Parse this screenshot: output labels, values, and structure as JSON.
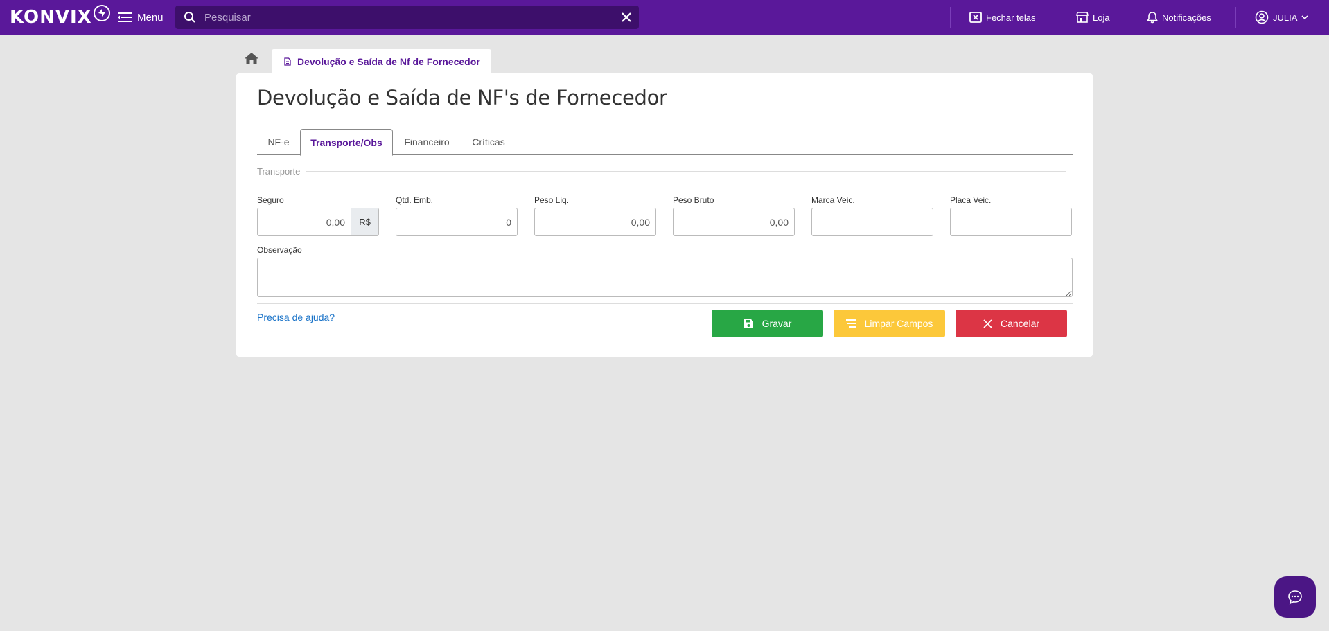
{
  "header": {
    "logo_text": "KONVIX",
    "menu_label": "Menu",
    "search_placeholder": "Pesquisar",
    "close_screens_label": "Fechar telas",
    "store_label": "Loja",
    "notifications_label": "Notificações",
    "user_label": "JULIA"
  },
  "tabstrip": {
    "page_tab_label": "Devolução e Saída de Nf de Fornecedor"
  },
  "page": {
    "title": "Devolução e Saída de NF's de Fornecedor",
    "tabs": [
      {
        "label": "NF-e"
      },
      {
        "label": "Transporte/Obs"
      },
      {
        "label": "Financeiro"
      },
      {
        "label": "Críticas"
      }
    ],
    "active_tab": "Transporte/Obs",
    "section_legend": "Transporte",
    "fields": {
      "seguro": {
        "label": "Seguro",
        "value": "0,00",
        "addon": "R$"
      },
      "qtd_emb": {
        "label": "Qtd. Emb.",
        "value": "0"
      },
      "peso_liq": {
        "label": "Peso Liq.",
        "value": "0,00"
      },
      "peso_bruto": {
        "label": "Peso Bruto",
        "value": "0,00"
      },
      "marca_veic": {
        "label": "Marca Veic.",
        "value": ""
      },
      "placa_veic": {
        "label": "Placa Veic.",
        "value": ""
      }
    },
    "observacao_label": "Observação",
    "help_link": "Precisa de ajuda?",
    "buttons": {
      "save": "Gravar",
      "clear": "Limpar Campos",
      "cancel": "Cancelar"
    }
  },
  "colors": {
    "brand": "#5a189a",
    "save": "#28a745",
    "clear": "#fcc83a",
    "cancel": "#dc3545",
    "link": "#1a73c8"
  }
}
